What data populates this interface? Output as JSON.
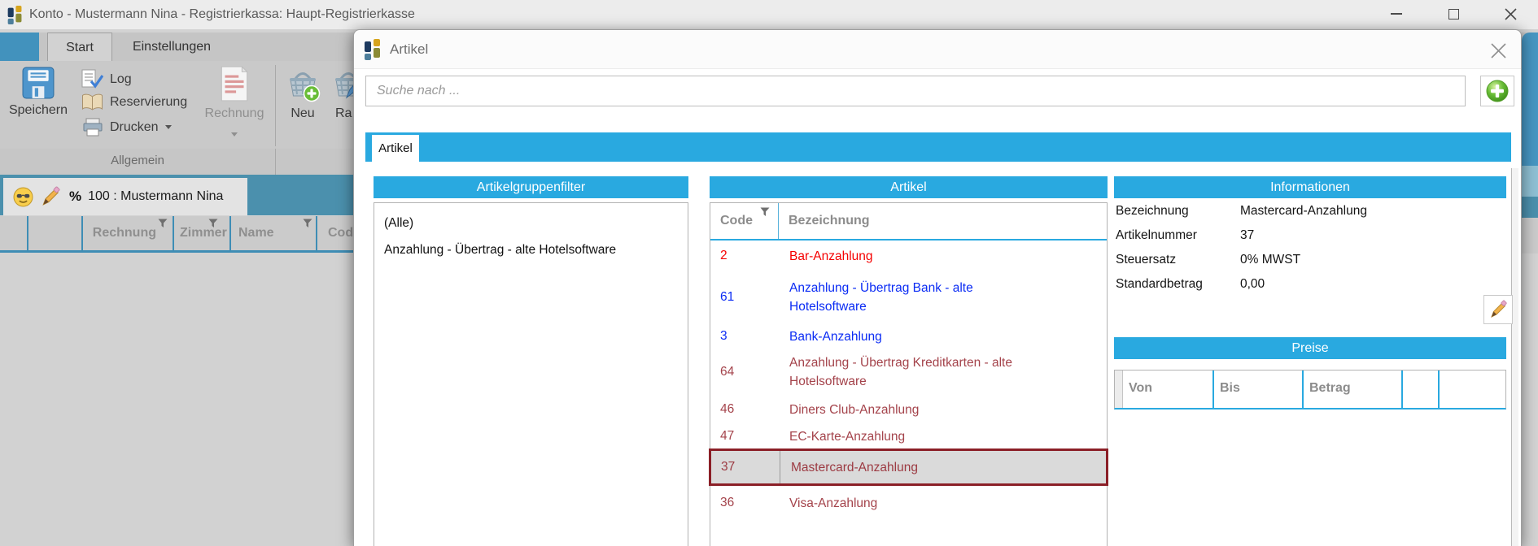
{
  "window": {
    "title": "Konto - Mustermann Nina - Registrierkassa: Haupt-Registrierkasse",
    "tabs": {
      "start": "Start",
      "settings": "Einstellungen"
    },
    "ribbon": {
      "save": "Speichern",
      "log": "Log",
      "reservation": "Reservierung",
      "print": "Drucken",
      "invoice": "Rechnung",
      "new": "Neu",
      "partial": "Ra",
      "group_general": "Allgemein"
    },
    "account_bar": {
      "percent": "%",
      "account": "100 :  Mustermann Nina"
    },
    "grid_headers": [
      "Rechnung",
      "Zimmer",
      "Name",
      "Code"
    ]
  },
  "dialog": {
    "title": "Artikel",
    "search": {
      "placeholder": "Suche nach ..."
    },
    "tab": "Artikel",
    "groups": {
      "title": "Artikelgruppenfilter",
      "items": [
        "(Alle)",
        "Anzahlung - Übertrag - alte Hotelsoftware"
      ]
    },
    "articles": {
      "title": "Artikel",
      "col_code": "Code",
      "col_name": "Bezeichnung",
      "rows": [
        {
          "code": "2",
          "name": "Bar-Anzahlung",
          "color": "red",
          "selected": false
        },
        {
          "code": "61",
          "name": "Anzahlung - Übertrag Bank - alte Hotelsoftware",
          "color": "blue",
          "selected": false
        },
        {
          "code": "3",
          "name": "Bank-Anzahlung",
          "color": "blue",
          "selected": false
        },
        {
          "code": "64",
          "name": "Anzahlung - Übertrag Kreditkarten - alte Hotelsoftware",
          "color": "darkred",
          "selected": false
        },
        {
          "code": "46",
          "name": "Diners Club-Anzahlung",
          "color": "darkred",
          "selected": false
        },
        {
          "code": "47",
          "name": "EC-Karte-Anzahlung",
          "color": "darkred",
          "selected": false
        },
        {
          "code": "37",
          "name": "Mastercard-Anzahlung",
          "color": "darkred",
          "selected": true
        },
        {
          "code": "36",
          "name": "Visa-Anzahlung",
          "color": "darkred",
          "selected": false
        }
      ]
    },
    "info": {
      "title": "Informationen",
      "rows": [
        {
          "label": "Bezeichnung",
          "value": "Mastercard-Anzahlung"
        },
        {
          "label": "Artikelnummer",
          "value": "37"
        },
        {
          "label": "Steuersatz",
          "value": "0% MWST"
        },
        {
          "label": "Standardbetrag",
          "value": "0,00"
        }
      ]
    },
    "prices": {
      "title": "Preise",
      "col_von": "Von",
      "col_bis": "Bis",
      "col_betrag": "Betrag"
    }
  },
  "colors": {
    "accent_blue": "#29a9e0",
    "dimmed_blue": "#4b90ad",
    "selection_border": "#8b1f27",
    "row_red": "#f50000",
    "row_blue": "#0a2bf4",
    "row_darkred": "#a4434b",
    "add_green": "#69bd37"
  }
}
